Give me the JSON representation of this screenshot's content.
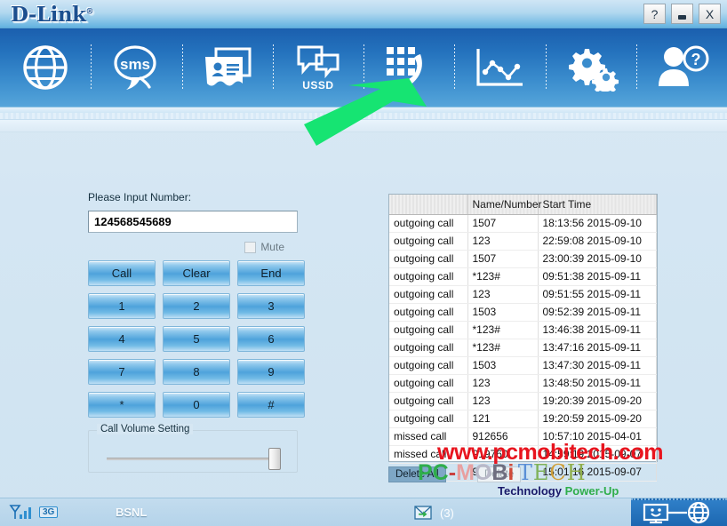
{
  "window": {
    "brand": "D-Link",
    "help_label": "?",
    "minimize_label": "",
    "close_label": "X"
  },
  "toolbar": {
    "items": [
      {
        "name": "internet-globe",
        "icon": "globe-icon",
        "label": ""
      },
      {
        "name": "sms",
        "icon": "sms-bubble-icon",
        "label": ""
      },
      {
        "name": "phonebook",
        "icon": "contact-card-icon",
        "label": ""
      },
      {
        "name": "ussd",
        "icon": "ussd-bubbles-icon",
        "label": "USSD"
      },
      {
        "name": "dial",
        "icon": "dialpad-handset-icon",
        "label": ""
      },
      {
        "name": "statistics",
        "icon": "line-chart-icon",
        "label": ""
      },
      {
        "name": "settings",
        "icon": "gears-icon",
        "label": ""
      },
      {
        "name": "help",
        "icon": "user-question-icon",
        "label": ""
      }
    ]
  },
  "annotation": {
    "arrow_color": "#16e472",
    "points_to": "dial"
  },
  "dialer": {
    "input_label": "Please Input Number:",
    "number_value": "124568545689",
    "number_placeholder": "",
    "mute_label": "Mute",
    "mute_checked": false,
    "actions": [
      "Call",
      "Clear",
      "End"
    ],
    "keys": [
      "1",
      "2",
      "3",
      "4",
      "5",
      "6",
      "7",
      "8",
      "9",
      "*",
      "0",
      "#"
    ],
    "volume_legend": "Call Volume Setting",
    "volume_value": 100
  },
  "call_log": {
    "columns": [
      "",
      "Name/Number",
      "Start Time"
    ],
    "rows": [
      [
        "outgoing call",
        "1507",
        "18:13:56 2015-09-10"
      ],
      [
        "outgoing call",
        "123",
        "22:59:08 2015-09-10"
      ],
      [
        "outgoing call",
        "1507",
        "23:00:39 2015-09-10"
      ],
      [
        "outgoing call",
        "*123#",
        "09:51:38 2015-09-11"
      ],
      [
        "outgoing call",
        "123",
        "09:51:55 2015-09-11"
      ],
      [
        "outgoing call",
        "1503",
        "09:52:39 2015-09-11"
      ],
      [
        "outgoing call",
        "*123#",
        "13:46:38 2015-09-11"
      ],
      [
        "outgoing call",
        "*123#",
        "13:47:16 2015-09-11"
      ],
      [
        "outgoing call",
        "1503",
        "13:47:30 2015-09-11"
      ],
      [
        "outgoing call",
        "123",
        "13:48:50 2015-09-11"
      ],
      [
        "outgoing call",
        "123",
        "19:20:39 2015-09-20"
      ],
      [
        "outgoing call",
        "121",
        "19:20:59 2015-09-20"
      ],
      [
        "missed call",
        "912656",
        "10:57:10 2015-04-01"
      ],
      [
        "missed call",
        "919760",
        "14:59:19 2015-09-07"
      ],
      [
        "missed call",
        "91976",
        "15:01:16 2015-09-07"
      ]
    ],
    "delete_all_label": "Delete All",
    "delete_label": "Delete"
  },
  "watermark": {
    "url": "www.pcmobitech.com",
    "logo_pc": "PC",
    "logo_dash": "-",
    "logo_m": "M",
    "logo_o": "O",
    "logo_b": "B",
    "logo_i": "i",
    "logo_tech": "TECH",
    "tagline_prefix": "Technology ",
    "tagline_suffix": "Power-Up"
  },
  "statusbar": {
    "signal_icon": "signal-bars-icon",
    "network_mode": "3G",
    "carrier": "BSNL",
    "mail_icon": "incoming-message-icon",
    "mail_count": "(3)",
    "connection_icon": "pc-to-internet-icon"
  }
}
